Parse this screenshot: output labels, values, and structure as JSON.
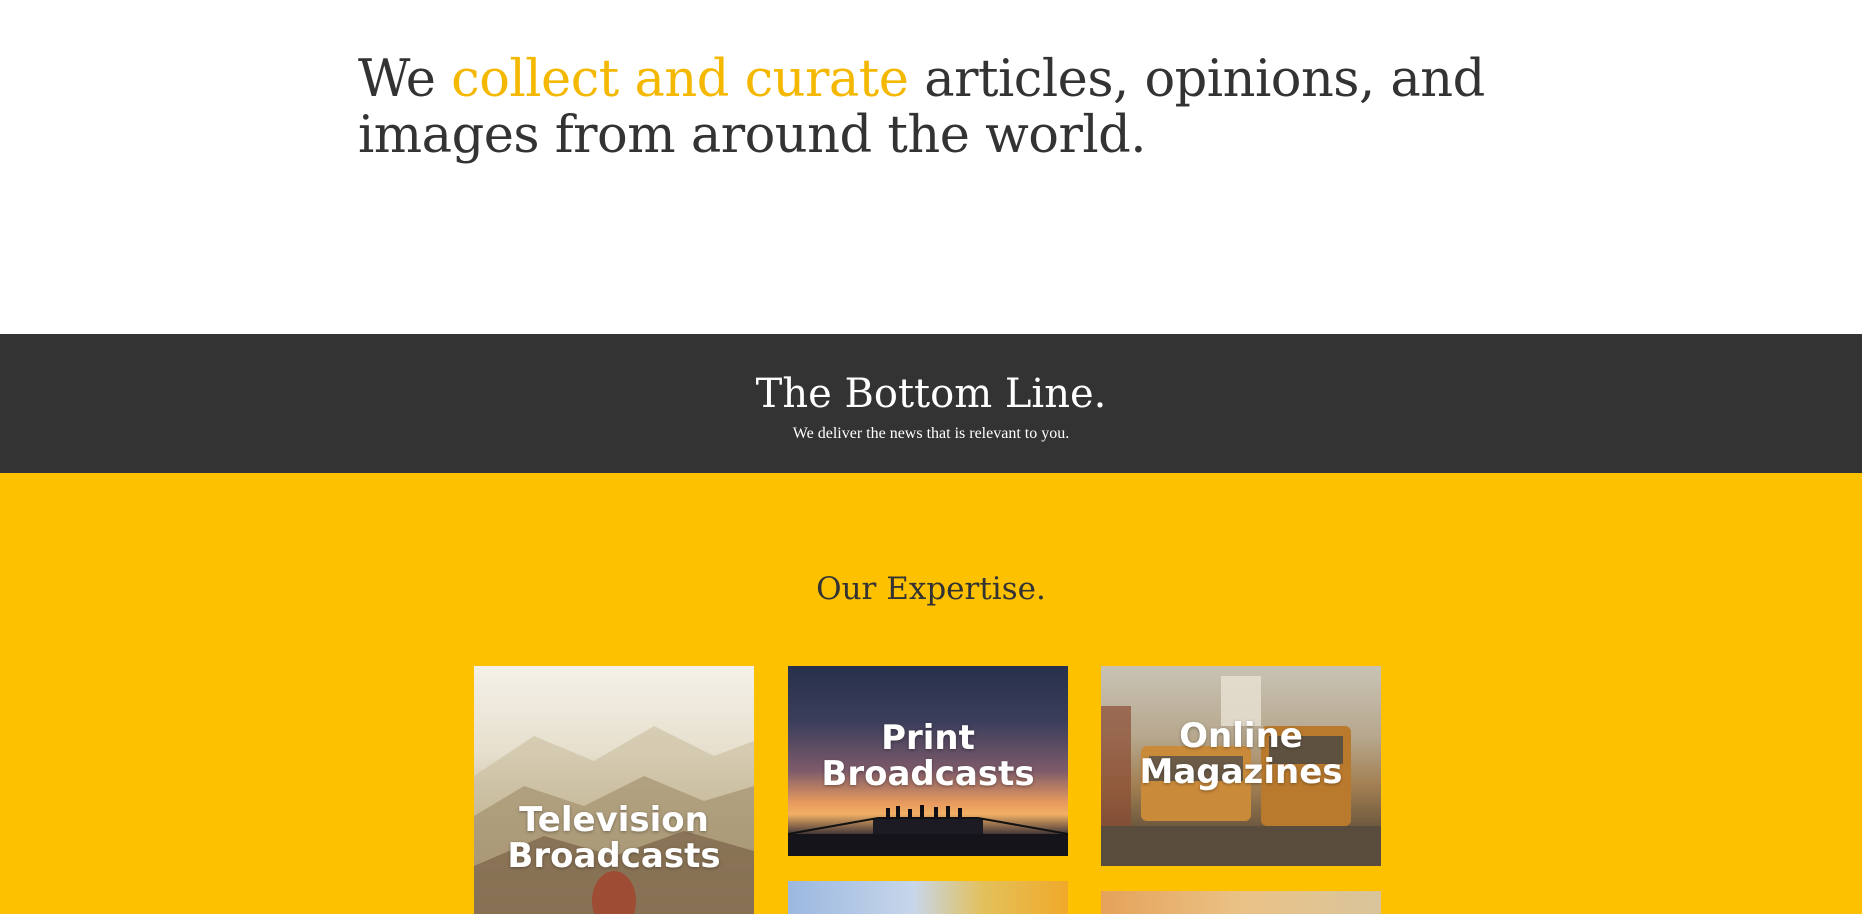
{
  "intro": {
    "prefix": "We ",
    "highlight": "collect and curate",
    "suffix": " articles, opinions, and images from around the world."
  },
  "bottom_line": {
    "title": "The Bottom Line.",
    "subtitle": "We deliver the news that is relevant to you."
  },
  "expertise": {
    "title": "Our Expertise.",
    "cards": [
      {
        "label": "Television\nBroadcasts"
      },
      {
        "label": "Print\nBroadcasts"
      },
      {
        "label": "Online\nMagazines"
      }
    ]
  },
  "colors": {
    "accent": "#fdc100",
    "highlight_text": "#f5b800",
    "dark_band": "#333333",
    "text": "#333333"
  }
}
